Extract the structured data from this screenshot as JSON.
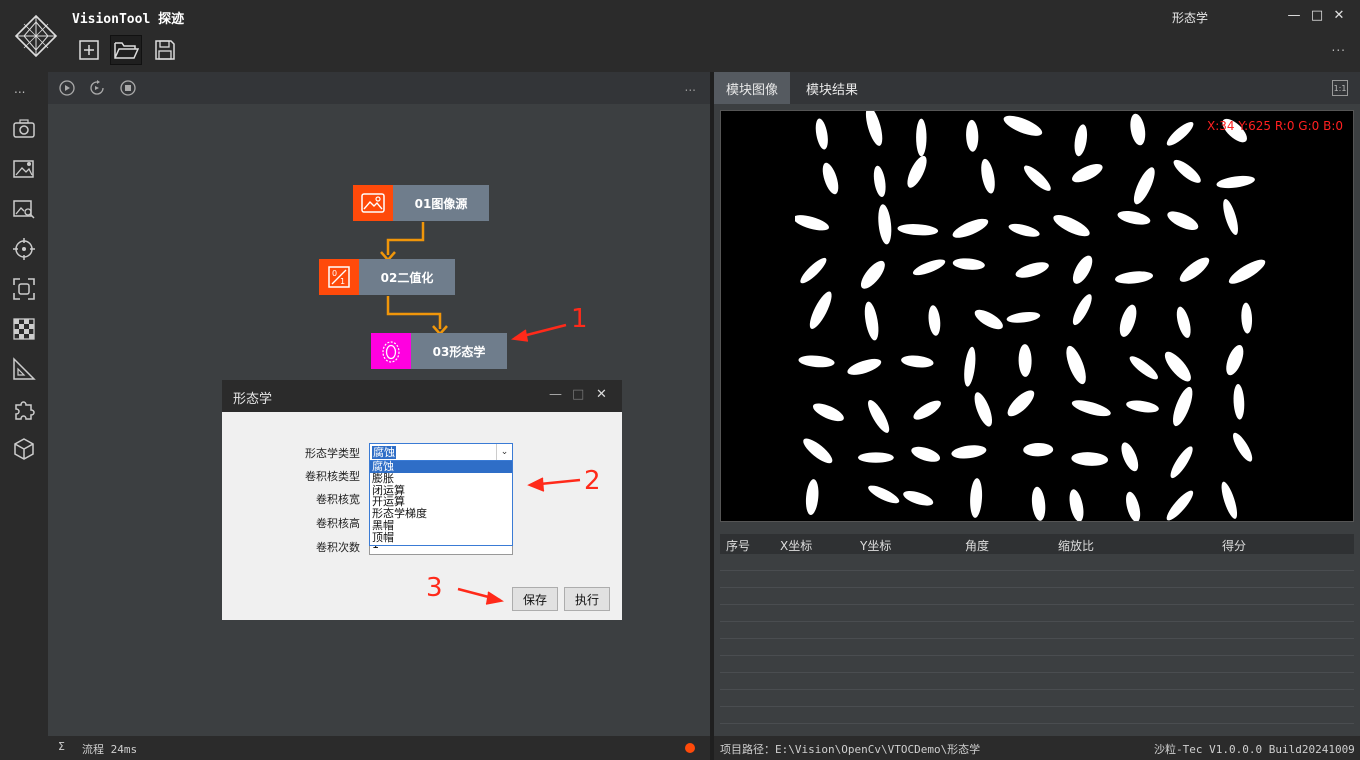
{
  "app": {
    "title": "VisionTool 探迹",
    "window_title": "形态学",
    "controls": {
      "minimize": "—",
      "maximize": "□",
      "close": "✕"
    },
    "more": "...",
    "toolbar": [
      {
        "name": "new-project-icon"
      },
      {
        "name": "open-folder-icon"
      },
      {
        "name": "save-icon"
      }
    ]
  },
  "sidebar": {
    "more": "...",
    "icons": [
      "camera-icon",
      "image-settings-icon",
      "image-search-icon",
      "crosshair-icon",
      "focus-frame-icon",
      "checkerboard-icon",
      "ruler-icon",
      "puzzle-icon",
      "cube-icon"
    ]
  },
  "flow": {
    "more": "...",
    "tools": [
      "run-icon",
      "run-loop-icon",
      "stop-icon"
    ],
    "nodes": [
      {
        "label": "01图像源",
        "color": "#ff4a0a",
        "icon": "image-icon"
      },
      {
        "label": "02二值化",
        "color": "#ff4a0a",
        "icon": "binarize-icon"
      },
      {
        "label": "03形态学",
        "color": "#ff00e0",
        "icon": "morphology-icon"
      }
    ],
    "status_sigma": "Σ",
    "status_text": "流程 24ms",
    "status_dot_color": "#ff4a0a"
  },
  "right": {
    "tabs": [
      {
        "label": "模块图像"
      },
      {
        "label": "模块结果"
      }
    ],
    "one_to_one": "1:1",
    "pixel_info": "X:34 Y:625  R:0 G:0 B:0",
    "results_headers": [
      "序号",
      "X坐标",
      "Y坐标",
      "角度",
      "缩放比",
      "得分"
    ],
    "project_path": "项目路径：E:\\Vision\\OpenCv\\VTOCDemo\\形态学",
    "version": "沙粒-Tec V1.0.0.0 Build20241009"
  },
  "dialog": {
    "title": "形态学",
    "controls": {
      "minimize": "—",
      "maximize": "□",
      "close": "✕"
    },
    "fields": [
      {
        "label": "形态学类型",
        "value": "腐蚀"
      },
      {
        "label": "卷积核类型",
        "value": ""
      },
      {
        "label": "卷积核宽",
        "value": ""
      },
      {
        "label": "卷积核高",
        "value": ""
      },
      {
        "label": "卷积次数",
        "value": "1"
      }
    ],
    "dropdown_options": [
      "腐蚀",
      "膨胀",
      "闭运算",
      "开运算",
      "形态学梯度",
      "黑帽",
      "顶帽"
    ],
    "selected_option": "腐蚀",
    "save_label": "保存",
    "execute_label": "执行"
  },
  "annotations": [
    {
      "text": "1"
    },
    {
      "text": "2"
    },
    {
      "text": "3"
    }
  ],
  "colors": {
    "accent_red": "#ff2a1a",
    "arrow_orange": "#f0960a",
    "node_label_bg": "#6f7d8c"
  }
}
